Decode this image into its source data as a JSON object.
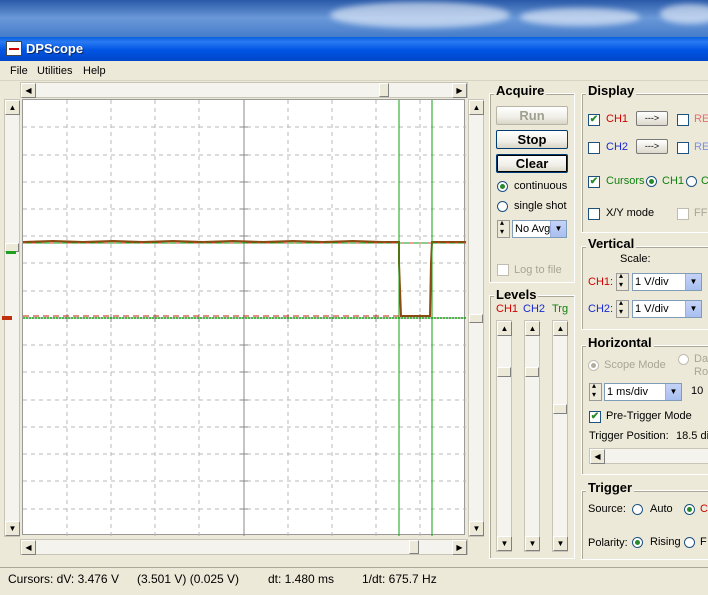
{
  "window": {
    "title": "DPScope"
  },
  "menu": [
    "File",
    "Utilities",
    "Help"
  ],
  "acquire": {
    "title": "Acquire",
    "run_label": "Run",
    "stop_label": "Stop",
    "clear_label": "Clear",
    "mode_continuous": "continuous",
    "mode_single": "single shot",
    "averaging": "No Avg",
    "log_to_file": "Log to file"
  },
  "levels": {
    "title": "Levels",
    "ch1": "CH1",
    "ch2": "CH2",
    "trg": "Trg"
  },
  "display": {
    "title": "Display",
    "ch1": "CH1",
    "ch2": "CH2",
    "arrow": "--->",
    "ref_a": "RE",
    "ref_b": "RE",
    "cursors": "Cursors",
    "cursor_ch1": "CH1",
    "cursor_c": "C",
    "xy_mode": "X/Y mode",
    "ff": "FF"
  },
  "vertical": {
    "title": "Vertical",
    "scale_label": "Scale:",
    "ch1_label": "CH1:",
    "ch1_scale": "1 V/div",
    "ch2_label": "CH2:",
    "ch2_scale": "1 V/div"
  },
  "horizontal": {
    "title": "Horizontal",
    "scope_mode": "Scope Mode",
    "data_mode_a": "Da",
    "data_mode_b": "Ro",
    "timebase": "1 ms/div",
    "extra": "10",
    "pretrigger": "Pre-Trigger Mode",
    "trigger_position_label": "Trigger Position:",
    "trigger_position_value": "18.5 di"
  },
  "trigger": {
    "title": "Trigger",
    "source_label": "Source:",
    "auto": "Auto",
    "other_source": "C",
    "polarity_label": "Polarity:",
    "rising": "Rising",
    "falling": "F"
  },
  "status": {
    "cursors": "Cursors: dV: 3.476 V",
    "pair": "(3.501 V) (0.025 V)",
    "dt": "dt: 1.480 ms",
    "inv_dt": "1/dt: 675.7 Hz"
  },
  "colors": {
    "titlebar": "#0054e3",
    "ch1": "#d00000",
    "ch2": "#1a2ad0",
    "cursor": "#109010",
    "trace": "#8a4a10"
  }
}
